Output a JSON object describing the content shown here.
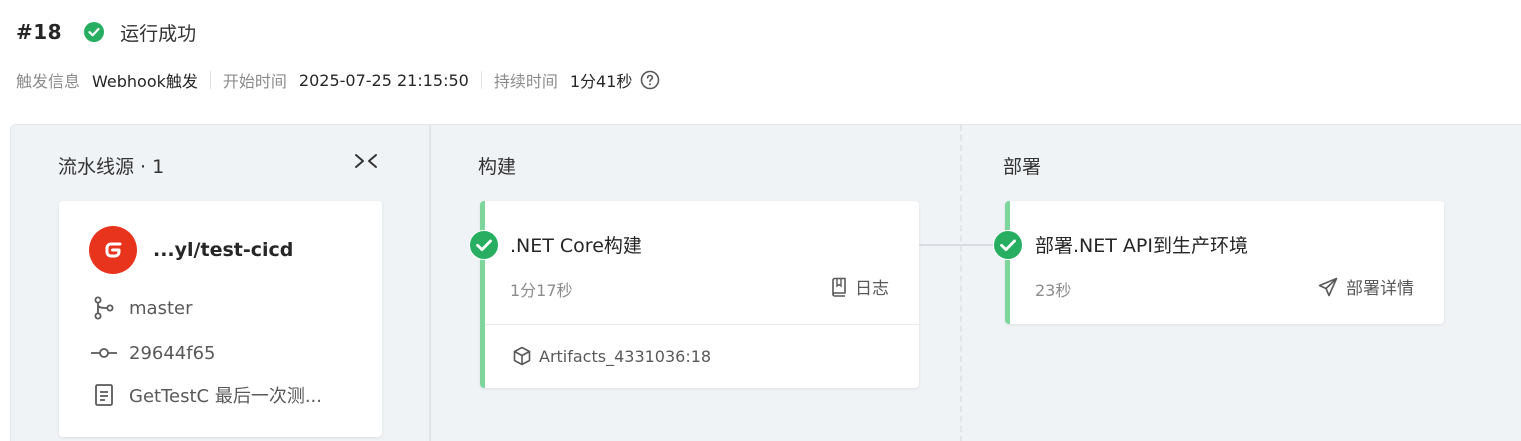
{
  "run": {
    "number": "#18",
    "status_text": "运行成功",
    "status_color": "#27ae60"
  },
  "meta": {
    "trigger_label": "触发信息",
    "trigger_value": "Webhook触发",
    "start_label": "开始时间",
    "start_value": "2025-07-25 21:15:50",
    "duration_label": "持续时间",
    "duration_value": "1分41秒",
    "help_icon": "question-circle-icon"
  },
  "source_stage": {
    "title": "流水线源 · 1",
    "collapse_icon": "collapse-icon",
    "repo_name": "...yl/test-cicd",
    "repo_logo_color": "#e8341c",
    "branch": "master",
    "commit": "29644f65",
    "message": "GetTestC 最后一次测..."
  },
  "build_stage": {
    "title": "构建",
    "job": {
      "name": ".NET Core构建",
      "duration": "1分17秒",
      "action_label": "日志",
      "action_icon": "book-icon",
      "artifact": "Artifacts_4331036:18",
      "artifact_icon": "cube-icon"
    }
  },
  "deploy_stage": {
    "title": "部署",
    "job": {
      "name": "部署.NET API到生产环境",
      "duration": "23秒",
      "action_label": "部署详情",
      "action_icon": "send-icon"
    }
  },
  "colors": {
    "success": "#27ae60",
    "accent_bar": "#7ed69c",
    "canvas_bg": "#f0f3f6"
  }
}
